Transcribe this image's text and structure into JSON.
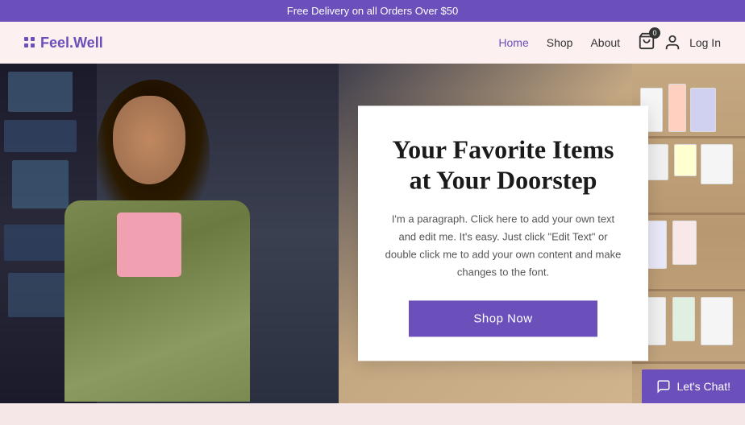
{
  "announcement": {
    "text": "Free Delivery on all Orders Over $50",
    "bg_color": "#6b4fbb"
  },
  "header": {
    "logo_text": "Feel.Well",
    "nav": [
      {
        "label": "Home",
        "active": true
      },
      {
        "label": "Shop",
        "active": false
      },
      {
        "label": "About",
        "active": false
      }
    ],
    "cart_count": "0",
    "login_label": "Log In"
  },
  "hero": {
    "card": {
      "title": "Your Favorite Items at Your Doorstep",
      "description": "I'm a paragraph. Click here to add your own text and edit me. It's easy. Just click \"Edit Text\" or double click me to add your own content and make changes to the font.",
      "cta_label": "Shop Now"
    }
  },
  "chat": {
    "label": "Let's Chat!"
  }
}
